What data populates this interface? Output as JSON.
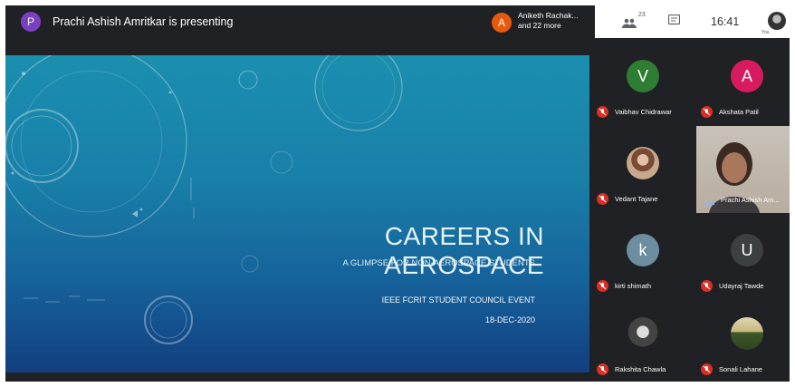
{
  "topbar": {
    "presenter_initial": "P",
    "presenter_text": "Prachi Ashish Amritkar is presenting",
    "others_initial": "A",
    "others_name": "Aniketh Rachak...",
    "others_more": "and 22 more"
  },
  "status": {
    "participant_count": "23",
    "time": "16:41",
    "self_label": "You"
  },
  "slide": {
    "title": "CAREERS IN AEROSPACE",
    "subtitle": "A GLIMPSE FOR NON-AEROSPACE STUDENTS",
    "event": "IEEE FCRIT STUDENT COUNCIL EVENT",
    "date": "18-DEC-2020"
  },
  "participants": [
    {
      "name": "Vaibhav Chidrawar",
      "initial": "V",
      "color": "#2e7d32",
      "muted": true,
      "kind": "letter"
    },
    {
      "name": "Akshata Patil",
      "initial": "A",
      "color": "#d81b60",
      "muted": true,
      "kind": "letter"
    },
    {
      "name": "Vedant Tajane",
      "initial": "",
      "muted": true,
      "kind": "photo"
    },
    {
      "name": "Prachi Ashish Am...",
      "initial": "",
      "muted": false,
      "kind": "video"
    },
    {
      "name": "kirti shimath",
      "initial": "k",
      "color": "#6c8ea0",
      "muted": true,
      "kind": "letter"
    },
    {
      "name": "Udayraj Tawde",
      "initial": "U",
      "color": "#3c4043",
      "muted": true,
      "kind": "letter"
    },
    {
      "name": "Rakshita Chawla",
      "initial": "",
      "muted": true,
      "kind": "photo"
    },
    {
      "name": "Sonali Lahane",
      "initial": "",
      "muted": true,
      "kind": "photo"
    }
  ],
  "icons": {
    "presenter": "avatar-p",
    "people": "people-icon",
    "chat": "chat-icon",
    "mute": "mic-off-icon",
    "speaking": "audio-wave-icon"
  }
}
